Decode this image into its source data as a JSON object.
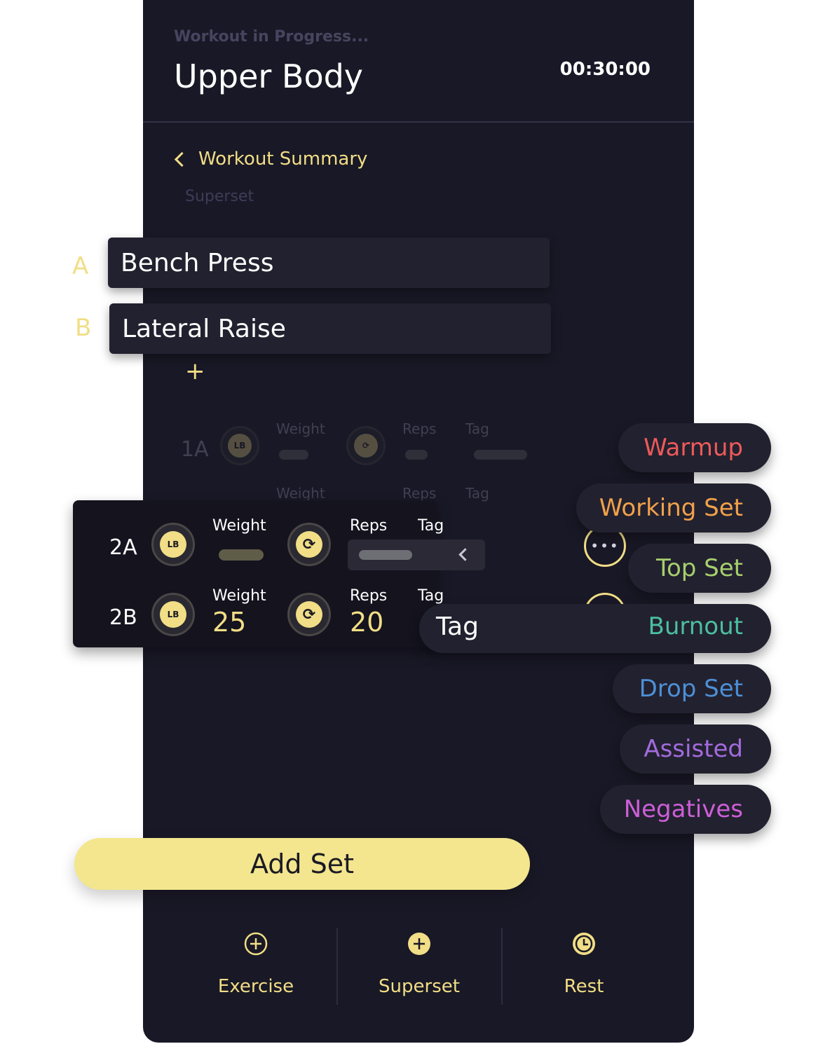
{
  "header": {
    "status": "Workout in Progress...",
    "title": "Upper Body",
    "timer": "00:30:00"
  },
  "nav": {
    "back_label": "Workout Summary",
    "section_label": "Superset"
  },
  "exercises": [
    {
      "letter": "A",
      "name": "Bench Press"
    },
    {
      "letter": "B",
      "name": "Lateral Raise"
    }
  ],
  "add_exercise_symbol": "+",
  "ghost_rows": {
    "set": "1A",
    "weight_label": "Weight",
    "reps_label": "Reps",
    "tag_label": "Tag"
  },
  "sets": [
    {
      "id": "2A",
      "weight_label": "Weight",
      "reps_label": "Reps",
      "tag_label": "Tag",
      "weight": "",
      "reps": ""
    },
    {
      "id": "2B",
      "weight_label": "Weight",
      "reps_label": "Reps",
      "tag_label": "Tag",
      "weight": "25",
      "reps": "20"
    }
  ],
  "weight_icon_text": "LB",
  "more_symbol": "•••",
  "tag_dropdown": {
    "label": "Tag",
    "selected": "Burnout",
    "options": [
      {
        "label": "Warmup",
        "color": "#ee5a5a"
      },
      {
        "label": "Working Set",
        "color": "#f2a14a"
      },
      {
        "label": "Top Set",
        "color": "#a6cf6e"
      },
      {
        "label": "Burnout",
        "color": "#4bbf9f"
      },
      {
        "label": "Drop Set",
        "color": "#4d8fd6"
      },
      {
        "label": "Assisted",
        "color": "#a36bde"
      },
      {
        "label": "Negatives",
        "color": "#cc5fd8"
      }
    ]
  },
  "add_set_label": "Add Set",
  "bottom_bar": [
    {
      "label": "Exercise",
      "icon": "plus-circle-outline-icon"
    },
    {
      "label": "Superset",
      "icon": "plus-circle-filled-icon"
    },
    {
      "label": "Rest",
      "icon": "clock-icon"
    }
  ],
  "colors": {
    "accent": "#f1de86",
    "background": "#191826"
  }
}
